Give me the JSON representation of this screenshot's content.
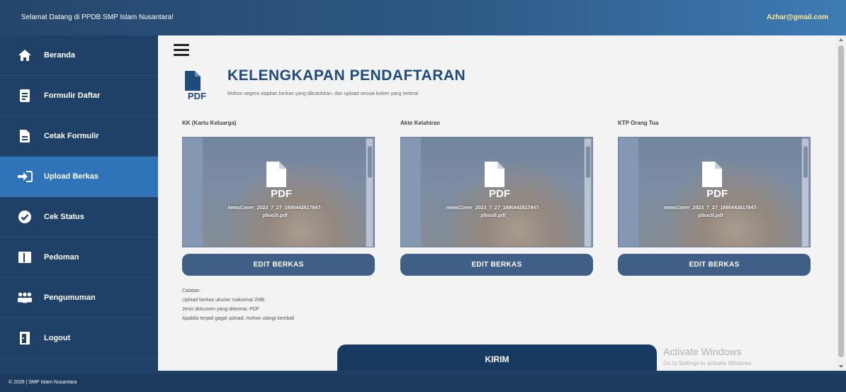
{
  "topbar": {
    "welcome": "Selamat Datang di PPDB SMP Islam Nusantara!",
    "email": "Azhar@gmail.com"
  },
  "sidebar": {
    "items": [
      {
        "label": "Beranda",
        "icon": "home-icon"
      },
      {
        "label": "Formulir Daftar",
        "icon": "form-icon"
      },
      {
        "label": "Cetak Formulir",
        "icon": "file-icon"
      },
      {
        "label": "Upload Berkas",
        "icon": "upload-icon",
        "active": true
      },
      {
        "label": "Cek Status",
        "icon": "check-circle-icon"
      },
      {
        "label": "Pedoman",
        "icon": "book-icon"
      },
      {
        "label": "Pengumuman",
        "icon": "users-icon"
      },
      {
        "label": "Logout",
        "icon": "logout-icon"
      }
    ]
  },
  "main": {
    "title": "KELENGKAPAN PENDAFTARAN",
    "subtitle": "Mohon segera siapkan berkas yang dibutuhkan, dan upload sesuai kolom yang tertera!",
    "header_icon_text": "PDF",
    "documents": [
      {
        "label": "KK (Kartu Keluarga)",
        "file_line1": "newsCover_2023_7_27_1690442617847-",
        "file_line2": "p5oo3l.pdf",
        "button": "EDIT BERKAS",
        "icon_text": "PDF"
      },
      {
        "label": "Akte Kelahiran",
        "file_line1": "newsCover_2023_7_27_1690442617847-",
        "file_line2": "p5oo3l.pdf",
        "button": "EDIT BERKAS",
        "icon_text": "PDF"
      },
      {
        "label": "KTP Orang Tua",
        "file_line1": "newsCover_2023_7_27_1690442617847-",
        "file_line2": "p5oo3l.pdf",
        "button": "EDIT BERKAS",
        "icon_text": "PDF"
      }
    ],
    "notes": {
      "heading": "Catatan :",
      "lines": [
        "Upload berkas ukuran maksimal 2MB",
        "Jenis dokumen yang diterima: PDF",
        "Apabila terjadi gagal upload, mohon ulangi kembali"
      ]
    },
    "submit_label": "KIRIM"
  },
  "watermark": {
    "line1": "Activate Windows",
    "line2": "Go to Settings to activate Windows."
  },
  "footer": {
    "text": "© 2026 | SMP Islam Nusantara"
  },
  "colors": {
    "sidebar_bg": "#1f4168",
    "active_item": "#2f73b8",
    "title": "#1f4b7a",
    "button": "#3f5f86",
    "submit": "#173a60"
  }
}
